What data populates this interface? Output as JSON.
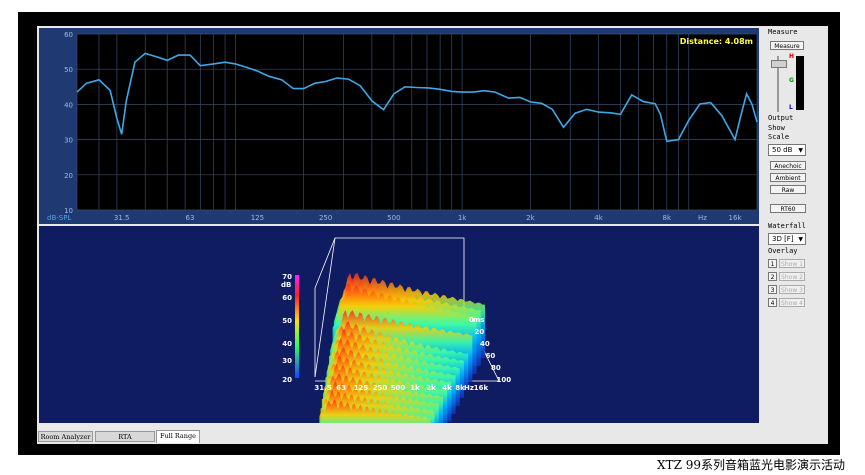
{
  "top_chart": {
    "unit_label": "dB-SPL",
    "distance": "Distance: 4.08m",
    "y_ticks": [
      "60",
      "50",
      "40",
      "30",
      "20",
      "10"
    ],
    "x_ticks": [
      "31.5",
      "63",
      "125",
      "250",
      "500",
      "1k",
      "2k",
      "4k",
      "8k",
      "Hz",
      "16k"
    ]
  },
  "chart_data": {
    "type": "line",
    "title": "",
    "xlabel": "Hz",
    "ylabel": "dB-SPL",
    "xscale": "log",
    "xlim": [
      20,
      20000
    ],
    "ylim": [
      10,
      60
    ],
    "grid": true,
    "x": [
      20,
      22,
      25,
      28,
      30,
      31.5,
      33,
      36,
      40,
      45,
      50,
      56,
      63,
      70,
      80,
      90,
      100,
      112,
      125,
      140,
      160,
      180,
      200,
      224,
      250,
      280,
      315,
      355,
      400,
      450,
      500,
      560,
      630,
      710,
      800,
      900,
      1000,
      1120,
      1250,
      1400,
      1600,
      1800,
      2000,
      2240,
      2500,
      2800,
      3150,
      3550,
      4000,
      4500,
      5000,
      5600,
      6300,
      7100,
      7500,
      8000,
      9000,
      10000,
      11200,
      12500,
      14000,
      16000,
      17000,
      18000,
      19000,
      20000
    ],
    "values": [
      43.5,
      46,
      47,
      44,
      36,
      31.5,
      41,
      52,
      54.5,
      53.5,
      52.5,
      54,
      54,
      51,
      51.5,
      52,
      51.5,
      50.5,
      49.5,
      48,
      47,
      44.5,
      44.5,
      46,
      46.5,
      47.5,
      47.2,
      45.3,
      41,
      38.5,
      43,
      45,
      44.8,
      44.7,
      44.3,
      43.7,
      43.5,
      43.5,
      43.9,
      43.5,
      41.8,
      42,
      40.7,
      40.3,
      38.6,
      33.5,
      37.5,
      38.6,
      37.8,
      37.6,
      37.2,
      42.7,
      40.8,
      40.2,
      37.2,
      29.5,
      30,
      35.5,
      40.1,
      40.5,
      36.8,
      30,
      37,
      43,
      40,
      35
    ]
  },
  "waterfall": {
    "type": "heatmap",
    "ylabel": "dB",
    "z_ticks": [
      "70",
      "60",
      "50",
      "40",
      "30",
      "20"
    ],
    "x_ticks": [
      "31.5",
      "63",
      "125",
      "250",
      "500",
      "1k",
      "2k",
      "4k",
      "8k",
      "Hz",
      "16k"
    ],
    "time_label": "ms",
    "time_ticks": [
      "0",
      "20",
      "40",
      "60",
      "80",
      "100"
    ]
  },
  "sidebar": {
    "measure_heading": "Measure",
    "measure_button": "Measure",
    "meter_h": "H",
    "meter_g": "G",
    "meter_l": "L",
    "output_label": "Output",
    "show_label": "Show",
    "scale_label": "Scale",
    "scale_value": "50 dB",
    "anechoic_button": "Anechoic",
    "ambient_button": "Ambient",
    "raw_button": "Raw",
    "rt60_button": "RT60",
    "waterfall_label": "Waterfall",
    "waterfall_value": "3D [F]",
    "overlay_label": "Overlay",
    "overlays": [
      {
        "num": "1",
        "label": "Show 1"
      },
      {
        "num": "2",
        "label": "Show 2"
      },
      {
        "num": "3",
        "label": "Show 3"
      },
      {
        "num": "4",
        "label": "Show 4"
      }
    ]
  },
  "tabs": [
    "Room Analyzer",
    "RTA",
    "Full Range"
  ],
  "caption": "XTZ 99系列音箱蓝光电影演示活动",
  "colors": {
    "curve": "#3fa8e8",
    "plot_bg": "#000000",
    "panel": "#1f3a72",
    "waterfall_bg": "#101c62",
    "distance": "#ffff40"
  }
}
